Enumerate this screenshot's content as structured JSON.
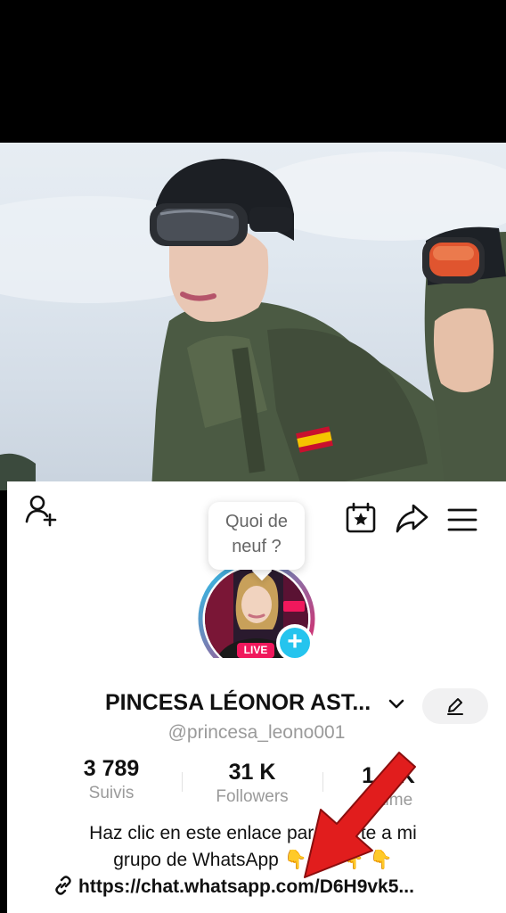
{
  "profile": {
    "name": "PINCESA LÉONOR AST...",
    "handle": "@princesa_leono001",
    "live_badge": "LIVE",
    "live_mini": "LIVE"
  },
  "bubble": {
    "line1": "Quoi de",
    "line2": "neuf ?"
  },
  "stats": [
    {
      "value": "3 789",
      "label": "Suivis"
    },
    {
      "value": "31 K",
      "label": "Followers"
    },
    {
      "value": "1... K",
      "label": "J'aime"
    }
  ],
  "bio": {
    "line1": "Haz clic en este enlace para unirte a mi",
    "line2": "grupo de WhatsApp 👇 👇 👇 👇",
    "link": "https://chat.whatsapp.com/D6H9vk5..."
  },
  "colors": {
    "accent": "#25c4ee",
    "live": "#f0185c",
    "arrow": "#e11d1d"
  }
}
